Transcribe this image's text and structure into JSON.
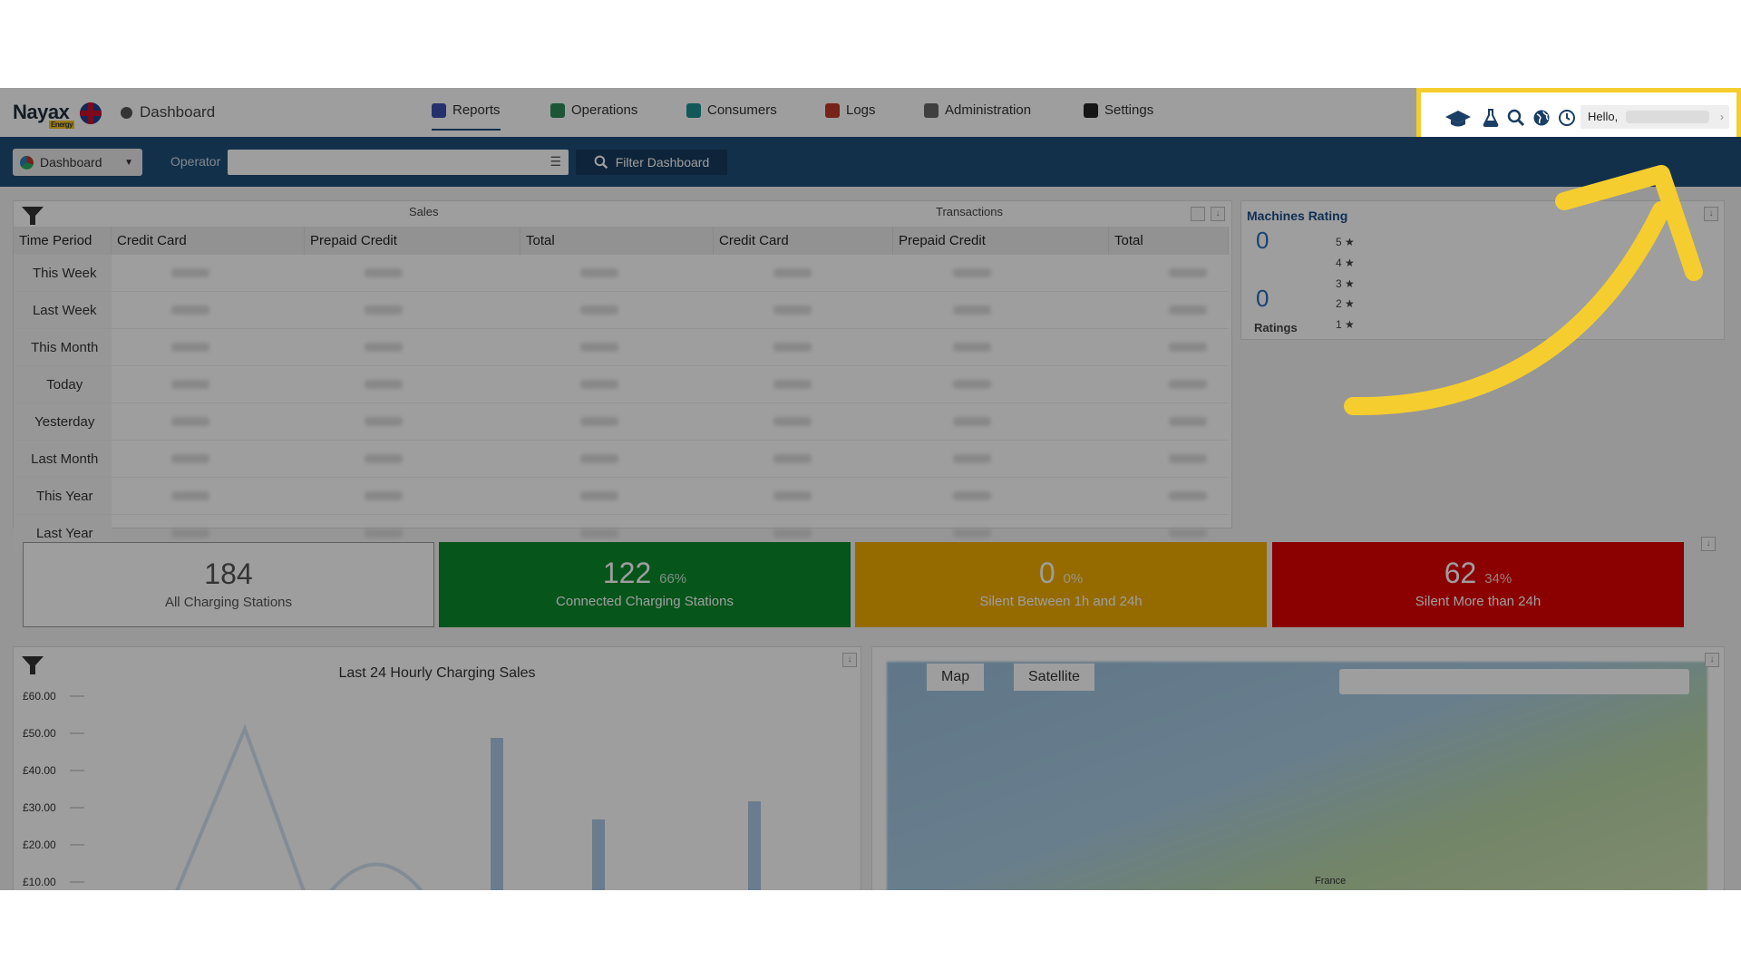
{
  "topnav": {
    "logo_text": "Nayax",
    "logo_sub": "Energy",
    "breadcrumb": "Dashboard",
    "tabs": [
      {
        "label": "Reports",
        "icon": "reports-icon",
        "color": "#3b4fb0"
      },
      {
        "label": "Operations",
        "icon": "operations-icon",
        "color": "#2e8b57"
      },
      {
        "label": "Consumers",
        "icon": "consumers-icon",
        "color": "#1f8f8f"
      },
      {
        "label": "Logs",
        "icon": "logs-icon",
        "color": "#c0392b"
      },
      {
        "label": "Administration",
        "icon": "administration-icon",
        "color": "#666666"
      },
      {
        "label": "Settings",
        "icon": "settings-icon",
        "color": "#222222"
      }
    ],
    "user": {
      "greeting": "Hello,"
    }
  },
  "filterbar": {
    "dropdown_label": "Dashboard",
    "operator_label": "Operator",
    "operator_value": "",
    "filter_button": "Filter Dashboard"
  },
  "sales": {
    "group_sales": "Sales",
    "group_transactions": "Transactions",
    "columns": [
      "Time Period",
      "Credit Card",
      "Prepaid Credit",
      "Total",
      "Credit Card",
      "Prepaid Credit",
      "Total"
    ],
    "periods": [
      "This Week",
      "Last Week",
      "This Month",
      "Today",
      "Yesterday",
      "Last Month",
      "This Year",
      "Last Year"
    ]
  },
  "rating": {
    "title": "Machines Rating",
    "value_top": "0",
    "value_bottom": "0",
    "ratings_label": "Ratings",
    "stars": [
      "5 ★",
      "4 ★",
      "3 ★",
      "2 ★",
      "1 ★"
    ]
  },
  "stats": [
    {
      "number": "184",
      "pct": "",
      "label": "All Charging Stations",
      "bg": "#ffffff",
      "fg": "#555555"
    },
    {
      "number": "122",
      "pct": "66%",
      "label": "Connected Charging Stations",
      "bg": "#0a8a2a",
      "fg": "#ffffff"
    },
    {
      "number": "0",
      "pct": "0%",
      "label": "Silent Between 1h and 24h",
      "bg": "#f0ad00",
      "fg": "#ffffff"
    },
    {
      "number": "62",
      "pct": "34%",
      "label": "Silent More than 24h",
      "bg": "#e00000",
      "fg": "#ffffff"
    }
  ],
  "chart_data": {
    "type": "bar",
    "title": "Last 24 Hourly Charging Sales",
    "y_ticks": [
      "£60.00",
      "£50.00",
      "£40.00",
      "£30.00",
      "£20.00",
      "£10.00"
    ],
    "ylim": [
      10,
      60
    ]
  },
  "map": {
    "tab_map": "Map",
    "tab_satellite": "Satellite",
    "label_france": "France"
  },
  "colors": {
    "nav_blue": "#1f4e7a",
    "highlight": "#f5cd2f"
  }
}
